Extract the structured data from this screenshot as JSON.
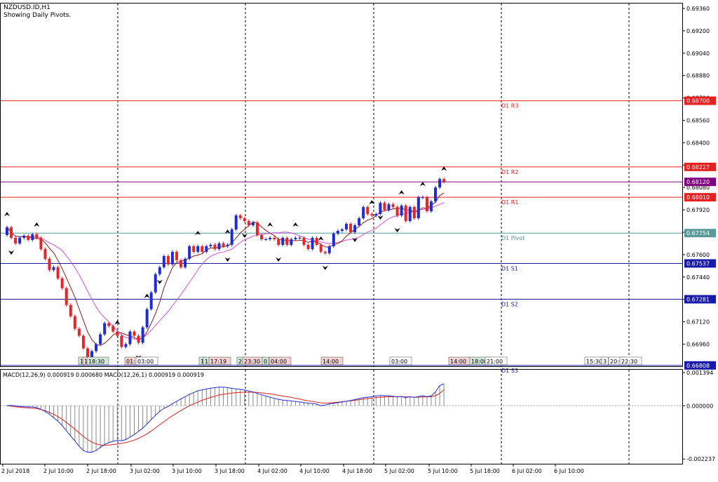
{
  "title": "NZDUSD.ID,H1",
  "subtitle": "Showing Daily Pivots.",
  "colors": {
    "bull": "#1f2bd6",
    "bear": "#e8242b",
    "ma_fast": "#8b1a1a",
    "ma_slow": "#e04fe0",
    "resistance": "#e82020",
    "support": "#1a1aaa",
    "pivot": "#5a9a9a",
    "current": "#800080",
    "macd_line": "#2233dd",
    "signal_line": "#e02020",
    "histogram": "#888888"
  },
  "chart_data": [
    {
      "type": "candlestick",
      "symbol": "NZDUSD.ID",
      "timeframe": "H1",
      "ylim": [
        0.6674,
        0.6943
      ],
      "y_ticks": [
        "0.69360",
        "0.69200",
        "0.69040",
        "0.68880",
        "0.68720",
        "0.68560",
        "0.68400",
        "0.68240",
        "0.68080",
        "0.67920",
        "0.67760",
        "0.67600",
        "0.67440",
        "0.67280",
        "0.67120",
        "0.66960"
      ],
      "x_ticks": [
        "2 Jul 2018",
        "2 Jul 10:00",
        "2 Jul 18:00",
        "3 Jul 02:00",
        "3 Jul 10:00",
        "3 Jul 18:00",
        "4 Jul 02:00",
        "4 Jul 10:00",
        "4 Jul 18:00",
        "5 Jul 02:00",
        "5 Jul 10:00",
        "5 Jul 18:00",
        "6 Jul 02:00",
        "6 Jul 10:00"
      ],
      "pivot_levels": [
        {
          "label": "D1 R3",
          "price": "0.68700",
          "value": 0.687,
          "kind": "resistance"
        },
        {
          "label": "D1 R2",
          "price": "0.68227",
          "value": 0.68227,
          "kind": "resistance"
        },
        {
          "label": "D1 R1",
          "price": "0.68010",
          "value": 0.6801,
          "kind": "resistance"
        },
        {
          "label": "D1 Pivot",
          "price": "0.67754",
          "value": 0.67754,
          "kind": "pivot"
        },
        {
          "label": "D1 S1",
          "price": "0.67537",
          "value": 0.67537,
          "kind": "support"
        },
        {
          "label": "D1 S2",
          "price": "0.67281",
          "value": 0.67281,
          "kind": "support"
        },
        {
          "label": "D1 S3",
          "price": "0.66808",
          "value": 0.66808,
          "kind": "support"
        }
      ],
      "current_price": {
        "price": "0.68120",
        "value": 0.6812
      },
      "series_close": [
        0.67795,
        0.6772,
        0.6768,
        0.6772,
        0.67735,
        0.67705,
        0.67745,
        0.6772,
        0.6764,
        0.6757,
        0.6749,
        0.6751,
        0.6743,
        0.6736,
        0.6724,
        0.6716,
        0.6707,
        0.6702,
        0.6693,
        0.6686,
        0.6691,
        0.6696,
        0.6703,
        0.6711,
        0.6709,
        0.6705,
        0.6702,
        0.6694,
        0.6696,
        0.6705,
        0.6702,
        0.6697,
        0.6708,
        0.6721,
        0.6733,
        0.6746,
        0.6751,
        0.6759,
        0.6753,
        0.6762,
        0.6756,
        0.6751,
        0.6757,
        0.6766,
        0.6762,
        0.6766,
        0.6762,
        0.6766,
        0.6767,
        0.6764,
        0.6768,
        0.6766,
        0.6767,
        0.6778,
        0.6788,
        0.6786,
        0.6784,
        0.6781,
        0.6783,
        0.6774,
        0.6771,
        0.6771,
        0.6772,
        0.6771,
        0.6767,
        0.6772,
        0.6767,
        0.6771,
        0.6772,
        0.6772,
        0.6767,
        0.6764,
        0.6772,
        0.6767,
        0.6762,
        0.6761,
        0.6766,
        0.6775,
        0.6777,
        0.6778,
        0.6782,
        0.6776,
        0.6781,
        0.6786,
        0.6794,
        0.6789,
        0.6788,
        0.6789,
        0.6797,
        0.6792,
        0.6796,
        0.6794,
        0.6788,
        0.6795,
        0.6784,
        0.6794,
        0.6786,
        0.6801,
        0.6801,
        0.6791,
        0.6798,
        0.6808,
        0.6814,
        0.6812
      ],
      "macd_label": "MACD(12,26,9) 0.000919 0.000680 MACD(12,26,1) 0.000919 0.000919",
      "macd_ticks": [
        "0.001394",
        "0.000000",
        "-0.002237"
      ],
      "macd_ylim": [
        -0.002237,
        0.001394
      ],
      "macd_line": [
        0.0,
        2e-05,
        -1e-05,
        -3e-05,
        -4e-05,
        -5e-05,
        -5e-05,
        -8e-05,
        -0.00015,
        -0.00024,
        -0.00036,
        -0.0005,
        -0.00065,
        -0.00083,
        -0.00105,
        -0.00127,
        -0.00148,
        -0.0017,
        -0.00188,
        -0.00195,
        -0.00195,
        -0.00188,
        -0.00175,
        -0.00163,
        -0.00155,
        -0.00149,
        -0.00146,
        -0.00147,
        -0.00142,
        -0.00132,
        -0.00121,
        -0.00108,
        -0.00094,
        -0.00077,
        -0.00058,
        -0.0004,
        -0.00024,
        -0.00011,
        -3e-05,
        9e-05,
        0.00019,
        0.00029,
        0.00038,
        0.00048,
        0.00055,
        0.00063,
        0.00067,
        0.0007,
        0.00074,
        0.00076,
        0.00078,
        0.00078,
        0.00076,
        0.00073,
        0.00071,
        0.00069,
        0.00066,
        0.00062,
        0.00058,
        0.00052,
        0.00046,
        0.00041,
        0.00036,
        0.00031,
        0.00027,
        0.00024,
        0.00022,
        0.0002,
        0.00018,
        0.00016,
        0.00013,
        0.00011,
        9e-05,
        7e-05,
        0.0,
        3e-05,
        8e-05,
        0.0001,
        0.00013,
        0.00016,
        0.00019,
        0.00022,
        0.00026,
        0.0003,
        0.00034,
        0.00036,
        0.00038,
        0.00041,
        0.00043,
        0.00042,
        0.00042,
        0.0004,
        0.00037,
        0.00039,
        0.00034,
        0.00038,
        0.00035,
        0.00039,
        0.00042,
        0.00038,
        0.00041,
        0.00058,
        0.00085,
        0.00092
      ],
      "signal_line": [
        0.0,
        -2e-05,
        -4e-05,
        -6e-05,
        -8e-05,
        -9e-05,
        -0.0001,
        -0.00012,
        -0.00016,
        -0.00021,
        -0.00028,
        -0.00036,
        -0.00046,
        -0.00057,
        -0.0007,
        -0.00084,
        -0.00099,
        -0.00114,
        -0.00129,
        -0.00142,
        -0.00153,
        -0.0016,
        -0.00165,
        -0.00166,
        -0.00165,
        -0.00163,
        -0.00161,
        -0.00158,
        -0.00155,
        -0.0015,
        -0.00144,
        -0.00137,
        -0.00128,
        -0.00118,
        -0.00106,
        -0.00093,
        -0.0008,
        -0.00067,
        -0.00054,
        -0.00042,
        -0.00031,
        -0.0002,
        -0.0001,
        0.0,
        8e-05,
        0.00016,
        0.00023,
        0.00029,
        0.00035,
        0.0004,
        0.00045,
        0.00048,
        0.00051,
        0.00053,
        0.00055,
        0.00056,
        0.00057,
        0.00057,
        0.00057,
        0.00056,
        0.00054,
        0.00052,
        0.0005,
        0.00047,
        0.00044,
        0.00041,
        0.00038,
        0.00035,
        0.00031,
        0.00028,
        0.00024,
        0.00021,
        0.00018,
        0.00015,
        0.00012,
        0.00011,
        0.00012,
        0.00013,
        0.00015,
        0.00017,
        0.00019,
        0.00021,
        0.00023,
        0.00025,
        0.00028,
        0.0003,
        0.00032,
        0.00034,
        0.00036,
        0.00037,
        0.00038,
        0.00038,
        0.00038,
        0.00038,
        0.00037,
        0.00037,
        0.00036,
        0.00036,
        0.00037,
        0.00037,
        0.00038,
        0.00042,
        0.00052,
        0.00068
      ],
      "markers": [
        {
          "label": "1",
          "tone": "green"
        },
        {
          "label": "1",
          "tone": "red"
        },
        {
          "label": "18:30",
          "tone": "green"
        },
        {
          "label": "01:",
          "tone": "red"
        },
        {
          "label": "03:00",
          "tone": "plain"
        },
        {
          "label": "1",
          "tone": "green"
        },
        {
          "label": "1",
          "tone": "green"
        },
        {
          "label": "17:19",
          "tone": "red"
        },
        {
          "label": "2",
          "tone": "green"
        },
        {
          "label": "23:30",
          "tone": "red"
        },
        {
          "label": "0",
          "tone": "green"
        },
        {
          "label": "04:00",
          "tone": "red"
        },
        {
          "label": "14:00",
          "tone": "red"
        },
        {
          "label": "03:00",
          "tone": "plain"
        },
        {
          "label": "14:00",
          "tone": "red"
        },
        {
          "label": "18:00",
          "tone": "green"
        },
        {
          "label": "21:00",
          "tone": "plain"
        },
        {
          "label": "15:30",
          "tone": "plain"
        },
        {
          "label": "3",
          "tone": "plain"
        },
        {
          "label": "20:0",
          "tone": "plain"
        },
        {
          "label": "22:30",
          "tone": "plain"
        }
      ]
    }
  ]
}
